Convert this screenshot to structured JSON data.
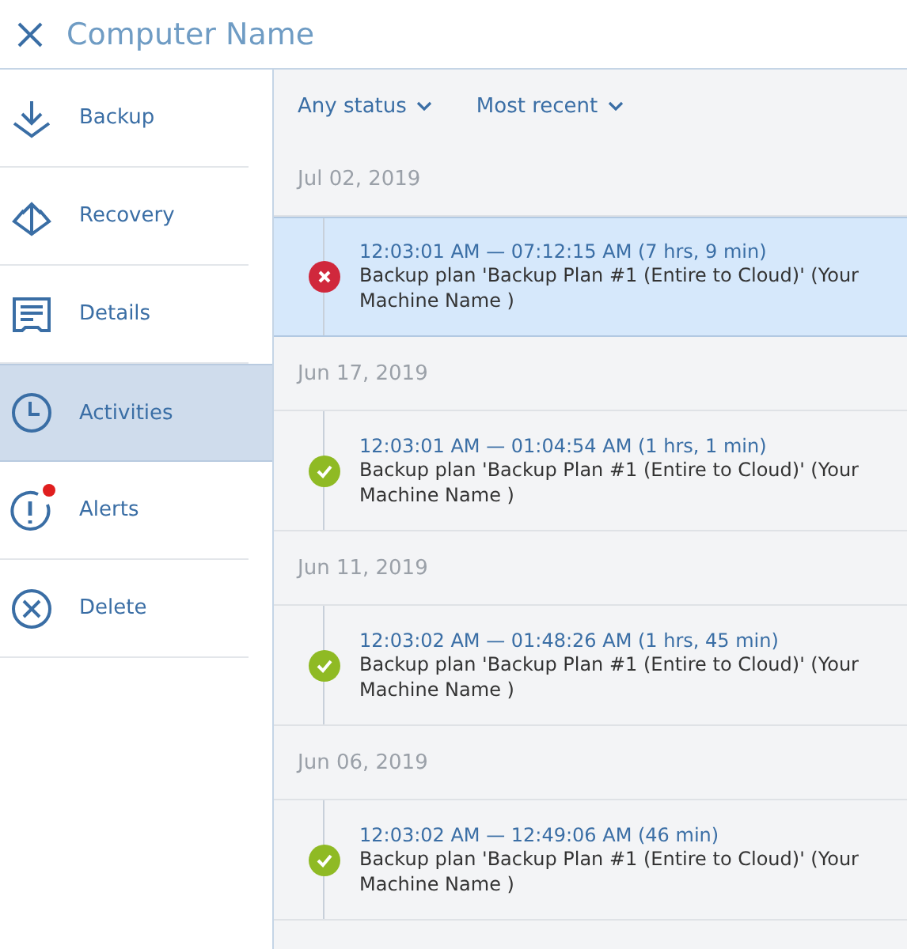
{
  "header": {
    "title": "Computer Name"
  },
  "sidebar": {
    "items": [
      {
        "label": "Backup",
        "kind": "backup",
        "selected": false
      },
      {
        "label": "Recovery",
        "kind": "recovery",
        "selected": false
      },
      {
        "label": "Details",
        "kind": "details",
        "selected": false
      },
      {
        "label": "Activities",
        "kind": "activities",
        "selected": true
      },
      {
        "label": "Alerts",
        "kind": "alerts",
        "selected": false,
        "badge": true
      },
      {
        "label": "Delete",
        "kind": "delete",
        "selected": false
      }
    ]
  },
  "filters": [
    "Any status",
    "Most recent"
  ],
  "groups": [
    {
      "date": "Jul 02, 2019",
      "activities": [
        {
          "kind": "error",
          "selected": true,
          "time": "12:03:01 AM — 07:12:15 AM (7 hrs, 9 min)",
          "description": "Backup plan 'Backup Plan #1 (Entire to Cloud)' (Your Machine Name )"
        }
      ]
    },
    {
      "date": "Jun 17, 2019",
      "activities": [
        {
          "kind": "success",
          "selected": false,
          "time": "12:03:01 AM — 01:04:54 AM (1 hrs, 1 min)",
          "description": "Backup plan 'Backup Plan #1 (Entire to Cloud)' (Your Machine Name )"
        }
      ]
    },
    {
      "date": "Jun 11, 2019",
      "activities": [
        {
          "kind": "success",
          "selected": false,
          "time": "12:03:02 AM — 01:48:26 AM (1 hrs, 45 min)",
          "description": "Backup plan 'Backup Plan #1 (Entire to Cloud)' (Your Machine Name )"
        }
      ]
    },
    {
      "date": "Jun 06, 2019",
      "activities": [
        {
          "kind": "success",
          "selected": false,
          "time": "12:03:02 AM — 12:49:06 AM (46 min)",
          "description": "Backup plan 'Backup Plan #1 (Entire to Cloud)' (Your Machine Name )"
        }
      ]
    }
  ]
}
